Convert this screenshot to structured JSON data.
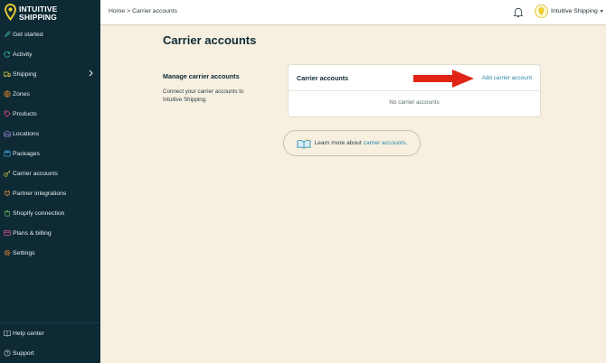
{
  "brand": {
    "line1": "INTUITIVE",
    "line2": "SHIPPING"
  },
  "sidebar": {
    "items": [
      {
        "label": "Get started",
        "icon": "rocket-icon"
      },
      {
        "label": "Activity",
        "icon": "refresh-icon"
      },
      {
        "label": "Shipping",
        "icon": "truck-icon",
        "has_children": true
      },
      {
        "label": "Zones",
        "icon": "globe-icon"
      },
      {
        "label": "Products",
        "icon": "tag-icon"
      },
      {
        "label": "Locations",
        "icon": "warehouse-icon"
      },
      {
        "label": "Packages",
        "icon": "package-icon"
      },
      {
        "label": "Carrier accounts",
        "icon": "key-icon"
      },
      {
        "label": "Partner integrations",
        "icon": "plug-icon"
      },
      {
        "label": "Shopify connection",
        "icon": "shopify-icon"
      },
      {
        "label": "Plans & billing",
        "icon": "credit-card-icon"
      },
      {
        "label": "Settings",
        "icon": "gear-icon"
      }
    ],
    "bottom": [
      {
        "label": "Help center",
        "icon": "book-icon"
      },
      {
        "label": "Support",
        "icon": "help-icon"
      }
    ]
  },
  "topbar": {
    "breadcrumb": {
      "home": "Home",
      "separator": ">",
      "current": "Carrier accounts"
    },
    "account_name": "Intuitive Shipping"
  },
  "main": {
    "title": "Carrier accounts",
    "section_title": "Manage carrier accounts",
    "section_desc": "Connect your carrier accounts to Intuitive Shipping.",
    "card": {
      "title": "Carrier accounts",
      "action": "Add carrier account",
      "empty": "No carrier accounts"
    },
    "learn": {
      "prefix": "Learn more about",
      "link": "carrier accounts."
    }
  },
  "colors": {
    "sidebar": "#0d2a35",
    "background": "#f7f0e1",
    "accent": "#2a86a6",
    "brand_yellow": "#f2d22e",
    "arrow": "#e02516"
  }
}
